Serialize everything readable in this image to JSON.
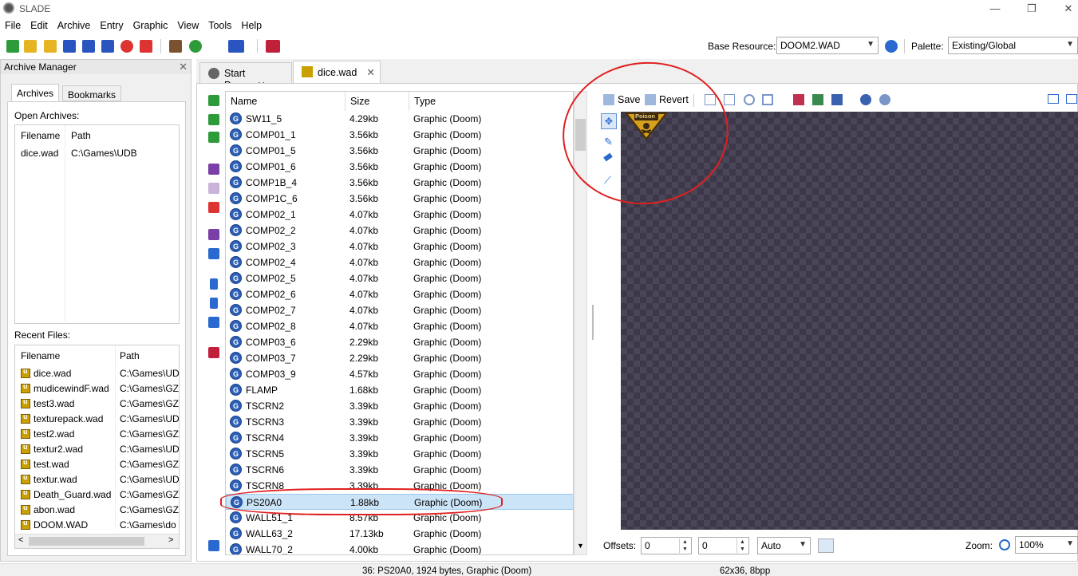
{
  "window": {
    "title": "SLADE",
    "minimize": "—",
    "maximize": "❐",
    "close": "✕"
  },
  "menu": [
    "File",
    "Edit",
    "Archive",
    "Entry",
    "Graphic",
    "View",
    "Tools",
    "Help"
  ],
  "toolbar": {
    "base_resource_label": "Base Resource:",
    "base_resource_value": "DOOM2.WAD",
    "palette_label": "Palette:",
    "palette_value": "Existing/Global"
  },
  "archive_manager": {
    "title": "Archive Manager",
    "tabs": [
      "Archives",
      "Bookmarks"
    ],
    "open_archives_label": "Open Archives:",
    "open_columns": [
      "Filename",
      "Path"
    ],
    "open_rows": [
      {
        "filename": "dice.wad",
        "path": "C:\\Games\\UDB"
      }
    ],
    "recent_label": "Recent Files:",
    "recent_columns": [
      "Filename",
      "Path"
    ],
    "recent_rows": [
      {
        "filename": "dice.wad",
        "path": "C:\\Games\\UD"
      },
      {
        "filename": "mudicewindF.wad",
        "path": "C:\\Games\\GZ"
      },
      {
        "filename": "test3.wad",
        "path": "C:\\Games\\GZ"
      },
      {
        "filename": "texturepack.wad",
        "path": "C:\\Games\\UD"
      },
      {
        "filename": "test2.wad",
        "path": "C:\\Games\\GZ"
      },
      {
        "filename": "textur2.wad",
        "path": "C:\\Games\\UD"
      },
      {
        "filename": "test.wad",
        "path": "C:\\Games\\GZ"
      },
      {
        "filename": "textur.wad",
        "path": "C:\\Games\\UD"
      },
      {
        "filename": "Death_Guard.wad",
        "path": "C:\\Games\\GZ"
      },
      {
        "filename": "abon.wad",
        "path": "C:\\Games\\GZ"
      },
      {
        "filename": "DOOM.WAD",
        "path": "C:\\Games\\do"
      }
    ]
  },
  "doc_tabs": [
    {
      "label": "Start Page",
      "close": "✕"
    },
    {
      "label": "dice.wad",
      "close": "✕"
    }
  ],
  "entry_list": {
    "columns": [
      "Name",
      "Size",
      "Type"
    ],
    "rows": [
      {
        "name": "SW11_5",
        "size": "4.29kb",
        "type": "Graphic (Doom)"
      },
      {
        "name": "COMP01_1",
        "size": "3.56kb",
        "type": "Graphic (Doom)"
      },
      {
        "name": "COMP01_5",
        "size": "3.56kb",
        "type": "Graphic (Doom)"
      },
      {
        "name": "COMP01_6",
        "size": "3.56kb",
        "type": "Graphic (Doom)"
      },
      {
        "name": "COMP1B_4",
        "size": "3.56kb",
        "type": "Graphic (Doom)"
      },
      {
        "name": "COMP1C_6",
        "size": "3.56kb",
        "type": "Graphic (Doom)"
      },
      {
        "name": "COMP02_1",
        "size": "4.07kb",
        "type": "Graphic (Doom)"
      },
      {
        "name": "COMP02_2",
        "size": "4.07kb",
        "type": "Graphic (Doom)"
      },
      {
        "name": "COMP02_3",
        "size": "4.07kb",
        "type": "Graphic (Doom)"
      },
      {
        "name": "COMP02_4",
        "size": "4.07kb",
        "type": "Graphic (Doom)"
      },
      {
        "name": "COMP02_5",
        "size": "4.07kb",
        "type": "Graphic (Doom)"
      },
      {
        "name": "COMP02_6",
        "size": "4.07kb",
        "type": "Graphic (Doom)"
      },
      {
        "name": "COMP02_7",
        "size": "4.07kb",
        "type": "Graphic (Doom)"
      },
      {
        "name": "COMP02_8",
        "size": "4.07kb",
        "type": "Graphic (Doom)"
      },
      {
        "name": "COMP03_6",
        "size": "2.29kb",
        "type": "Graphic (Doom)"
      },
      {
        "name": "COMP03_7",
        "size": "2.29kb",
        "type": "Graphic (Doom)"
      },
      {
        "name": "COMP03_9",
        "size": "4.57kb",
        "type": "Graphic (Doom)"
      },
      {
        "name": "FLAMP",
        "size": "1.68kb",
        "type": "Graphic (Doom)"
      },
      {
        "name": "TSCRN2",
        "size": "3.39kb",
        "type": "Graphic (Doom)"
      },
      {
        "name": "TSCRN3",
        "size": "3.39kb",
        "type": "Graphic (Doom)"
      },
      {
        "name": "TSCRN4",
        "size": "3.39kb",
        "type": "Graphic (Doom)"
      },
      {
        "name": "TSCRN5",
        "size": "3.39kb",
        "type": "Graphic (Doom)"
      },
      {
        "name": "TSCRN6",
        "size": "3.39kb",
        "type": "Graphic (Doom)"
      },
      {
        "name": "TSCRN8",
        "size": "3.39kb",
        "type": "Graphic (Doom)"
      },
      {
        "name": "PS20A0",
        "size": "1.88kb",
        "type": "Graphic (Doom)",
        "selected": true
      },
      {
        "name": "WALL51_1",
        "size": "8.57kb",
        "type": "Graphic (Doom)"
      },
      {
        "name": "WALL63_2",
        "size": "17.13kb",
        "type": "Graphic (Doom)"
      },
      {
        "name": "WALL70_2",
        "size": "4.00kb",
        "type": "Graphic (Doom)"
      }
    ]
  },
  "graphic_editor": {
    "save_label": "Save",
    "revert_label": "Revert",
    "preview_text": "Poison",
    "offsets_label": "Offsets:",
    "offset_x": "0",
    "offset_y": "0",
    "offset_mode": "Auto",
    "zoom_label": "Zoom:",
    "zoom_value": "100%"
  },
  "status": {
    "entry_info": "36: PS20A0, 1924 bytes, Graphic (Doom)",
    "image_info": "62x36, 8bpp"
  },
  "colors": {
    "annotation": "#e02020",
    "selection": "#cce4f7",
    "canvas": "#3d3849"
  }
}
